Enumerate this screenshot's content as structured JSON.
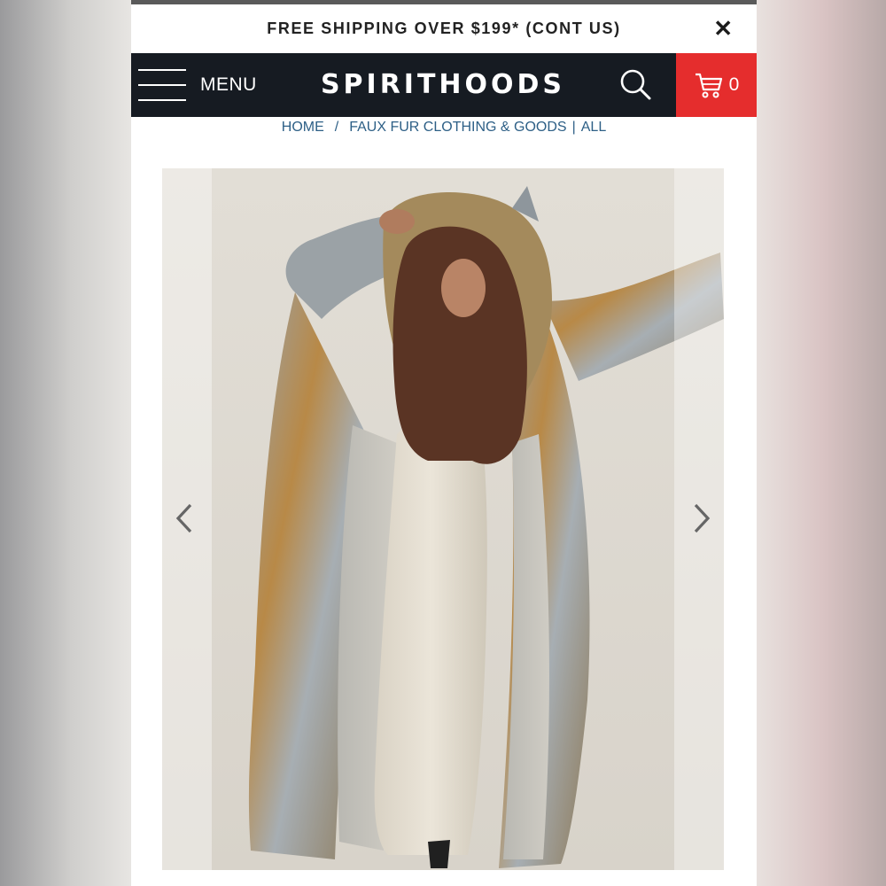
{
  "promo": {
    "text": "FREE SHIPPING OVER $199* (CONT US)",
    "close_icon": "close-icon",
    "close_glyph": "✕"
  },
  "header": {
    "menu_label": "MENU",
    "logo_text": "SPIRITHOODS",
    "search_icon": "search-icon",
    "cart_icon": "cart-icon",
    "cart_count": "0",
    "background": "#161b22",
    "cart_background": "#e52d2d"
  },
  "breadcrumb": {
    "home": "HOME",
    "separator": "/",
    "category": "FAUX FUR CLOTHING & GOODS",
    "divider": "|",
    "all": "ALL"
  },
  "gallery": {
    "image_alt_icon": "product-photo",
    "prev_icon": "chevron-left-icon",
    "next_icon": "chevron-right-icon"
  }
}
